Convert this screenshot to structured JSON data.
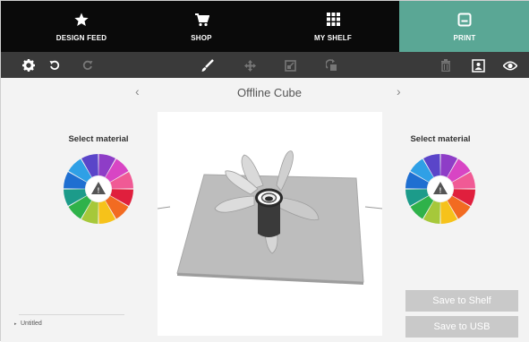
{
  "nav": {
    "tabs": [
      {
        "id": "design_feed",
        "label": "DESIGN FEED",
        "icon": "star-icon"
      },
      {
        "id": "shop",
        "label": "SHOP",
        "icon": "cart-icon"
      },
      {
        "id": "my_shelf",
        "label": "MY SHELF",
        "icon": "grid-icon"
      },
      {
        "id": "print",
        "label": "PRINT",
        "icon": "printer-icon",
        "active": true
      }
    ],
    "active_color": "#5aa795"
  },
  "toolbar": {
    "left_icons": [
      "gear-icon",
      "undo-icon",
      "redo-icon"
    ],
    "center_icons": [
      "brush-icon",
      "move-icon",
      "scale-icon",
      "rotate-icon"
    ],
    "right_icons": [
      "trash-icon",
      "camera-icon",
      "eye-icon"
    ]
  },
  "viewer": {
    "title": "Offline Cube",
    "prev_arrow": "‹",
    "next_arrow": "›"
  },
  "materials": {
    "left_title": "Select material",
    "right_title": "Select material",
    "warning_glyph": "!",
    "colors": [
      "#8e3dc7",
      "#d845c4",
      "#f05a95",
      "#e01f3d",
      "#f26b21",
      "#f6c21a",
      "#a6c83a",
      "#2fb24a",
      "#1c9b8a",
      "#1f6fd1",
      "#2fa0e6",
      "#5a45c9"
    ]
  },
  "files": {
    "current_name": "Untitled",
    "marker": "▸"
  },
  "actions": {
    "save_to_shelf": "Save to Shelf",
    "save_to_usb": "Save to USB"
  }
}
